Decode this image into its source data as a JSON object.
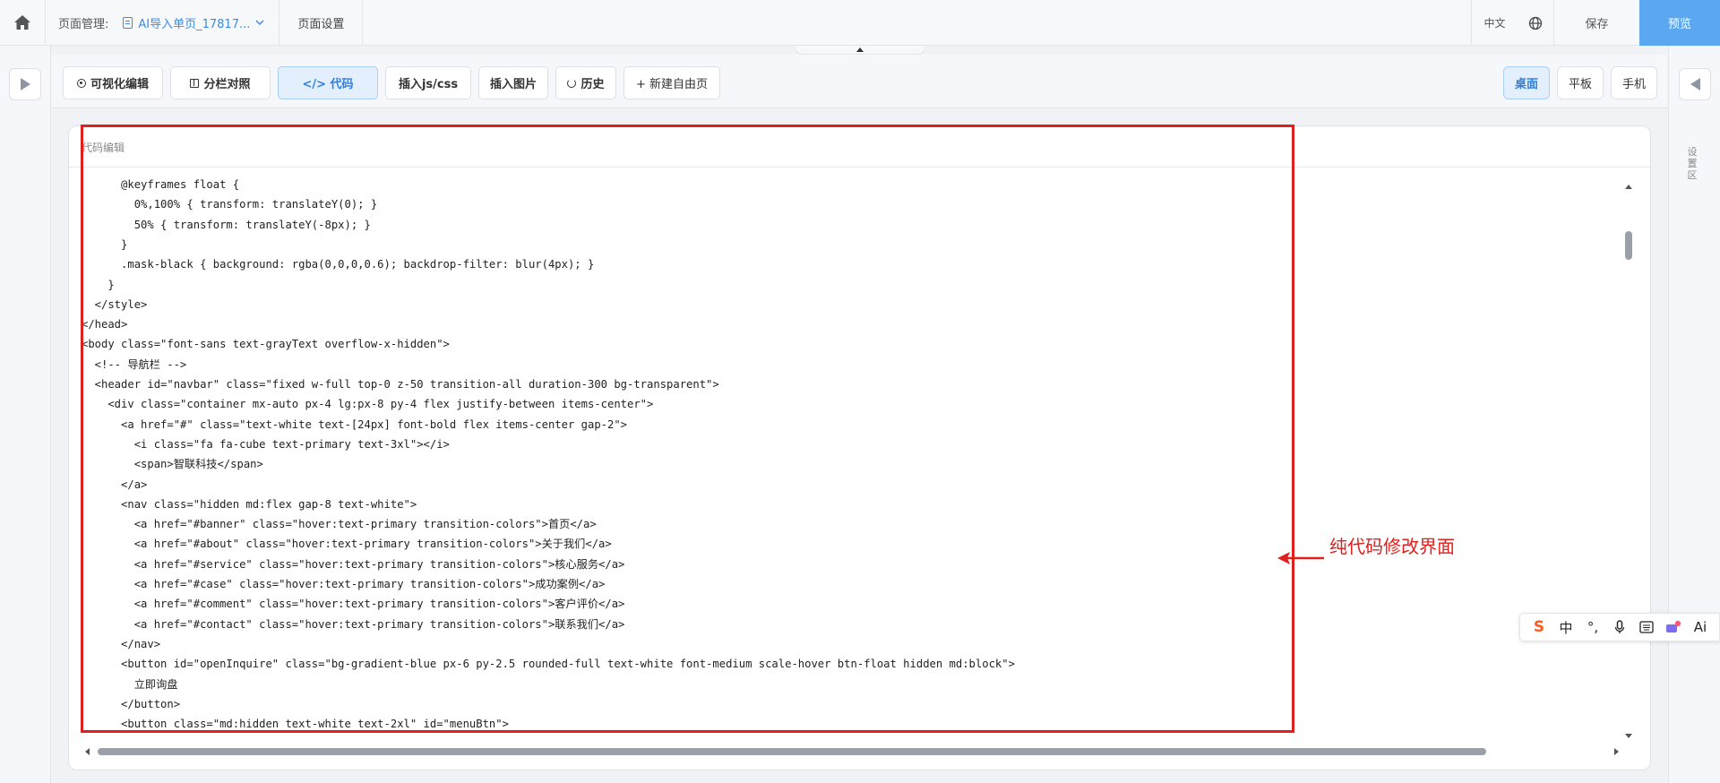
{
  "topbar": {
    "page_manage_label": "页面管理:",
    "current_page": "AI导入单页_17817...",
    "page_settings": "页面设置",
    "language": "中文",
    "save": "保存",
    "preview": "预览"
  },
  "toolbar": {
    "visual_edit": "可视化编辑",
    "split_compare": "分栏对照",
    "code": "</> 代码",
    "insert_js_css": "插入js/css",
    "insert_image": "插入图片",
    "history": "历史",
    "new_free_page": "+ 新建自由页",
    "active_tab": "code"
  },
  "devices": {
    "desktop": "桌面",
    "tablet": "平板",
    "mobile": "手机",
    "active": "desktop"
  },
  "right_rail": {
    "label": "设置区"
  },
  "editor": {
    "title": "代码编辑",
    "lines": [
      "      @keyframes float {",
      "        0%,100% { transform: translateY(0); }",
      "        50% { transform: translateY(-8px); }",
      "      }",
      "      .mask-black { background: rgba(0,0,0,0.6); backdrop-filter: blur(4px); }",
      "    }",
      "  </style>",
      "</head>",
      "<body class=\"font-sans text-grayText overflow-x-hidden\">",
      "  <!-- 导航栏 -->",
      "  <header id=\"navbar\" class=\"fixed w-full top-0 z-50 transition-all duration-300 bg-transparent\">",
      "    <div class=\"container mx-auto px-4 lg:px-8 py-4 flex justify-between items-center\">",
      "      <a href=\"#\" class=\"text-white text-[24px] font-bold flex items-center gap-2\">",
      "        <i class=\"fa fa-cube text-primary text-3xl\"></i>",
      "        <span>智联科技</span>",
      "      </a>",
      "      <nav class=\"hidden md:flex gap-8 text-white\">",
      "        <a href=\"#banner\" class=\"hover:text-primary transition-colors\">首页</a>",
      "        <a href=\"#about\" class=\"hover:text-primary transition-colors\">关于我们</a>",
      "        <a href=\"#service\" class=\"hover:text-primary transition-colors\">核心服务</a>",
      "        <a href=\"#case\" class=\"hover:text-primary transition-colors\">成功案例</a>",
      "        <a href=\"#comment\" class=\"hover:text-primary transition-colors\">客户评价</a>",
      "        <a href=\"#contact\" class=\"hover:text-primary transition-colors\">联系我们</a>",
      "      </nav>",
      "      <button id=\"openInquire\" class=\"bg-gradient-blue px-6 py-2.5 rounded-full text-white font-medium scale-hover btn-float hidden md:block\">",
      "        立即询盘",
      "      </button>",
      "      <button class=\"md:hidden text-white text-2xl\" id=\"menuBtn\">"
    ]
  },
  "annotation": {
    "text": "纯代码修改界面",
    "color": "#e0201d"
  },
  "ime_bar": {
    "chinese_mode": "中",
    "ai": "Ai"
  },
  "colors": {
    "accent": "#5ba8f0",
    "active_tab_bg": "#e3effd",
    "annotation": "#e0201d"
  }
}
